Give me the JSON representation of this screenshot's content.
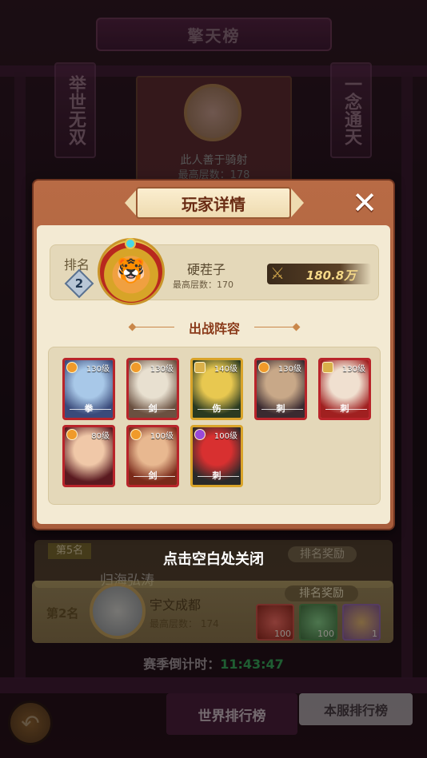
{
  "background": {
    "page_title": "擎天榜",
    "banner_left": "举世无双",
    "banner_right": "一念通天",
    "top1": {
      "name": "此人善于骑射",
      "floor": "最高层数：178"
    },
    "row5": {
      "rank": "第5名",
      "name": "归海弘涛",
      "reward_title": "排名奖励"
    },
    "row2": {
      "rank": "第2名",
      "name": "宇文成都",
      "floor": "最高层数： 174",
      "reward_title": "排名奖励",
      "rewards": [
        {
          "icon": "red-orb-icon",
          "count": "100"
        },
        {
          "icon": "jade-item-icon",
          "count": "100"
        },
        {
          "icon": "money-bag-icon",
          "count": "1"
        }
      ]
    },
    "close_hint": "点击空白处关闭",
    "countdown_label": "赛季倒计时：",
    "countdown_time": "11:43:47",
    "tab_world": "世界排行榜",
    "tab_server": "本服排行榜"
  },
  "modal": {
    "title": "玩家详情",
    "close_glyph": "✕",
    "rank_label": "排名",
    "rank_value": "2",
    "player_name": "硬茬子",
    "player_floor": "最高层数：170",
    "power": "180.8万",
    "lineup_title": "出战阵容",
    "heroes": [
      {
        "level": "130级",
        "role": "拳",
        "frame": "red",
        "type": "orange",
        "colors": [
          "#a8c8e8",
          "#3a4a7a"
        ]
      },
      {
        "level": "130级",
        "role": "剑",
        "frame": "red",
        "type": "orange",
        "colors": [
          "#e8e0d0",
          "#6a5040"
        ]
      },
      {
        "level": "140级",
        "role": "伤",
        "frame": "gold",
        "type": "shield",
        "colors": [
          "#e8c850",
          "#2a3a20"
        ]
      },
      {
        "level": "130级",
        "role": "刺",
        "frame": "red",
        "type": "orange",
        "colors": [
          "#c8a888",
          "#3a2a30"
        ]
      },
      {
        "level": "130级",
        "role": "刺",
        "frame": "red",
        "type": "shield",
        "colors": [
          "#f0e0d0",
          "#a02020"
        ]
      },
      {
        "level": "80级",
        "role": "",
        "frame": "red",
        "type": "orange",
        "colors": [
          "#f0c8a8",
          "#5a1a20"
        ]
      },
      {
        "level": "100级",
        "role": "剑",
        "frame": "red",
        "type": "orange",
        "colors": [
          "#e8b890",
          "#7a2a1a"
        ]
      },
      {
        "level": "100级",
        "role": "刺",
        "frame": "gold",
        "type": "purple",
        "colors": [
          "#d83030",
          "#2a2a2a"
        ]
      }
    ]
  }
}
